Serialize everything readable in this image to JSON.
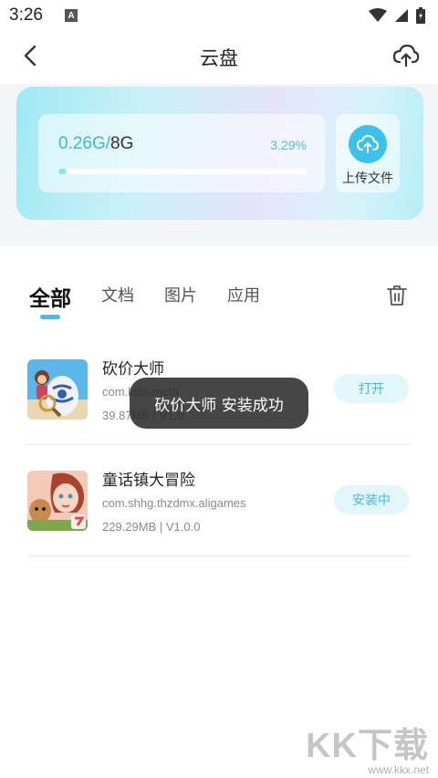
{
  "status_bar": {
    "time": "3:26",
    "notification_letter": "A"
  },
  "header": {
    "title": "云盘"
  },
  "storage": {
    "used": "0.26G",
    "separator": "/",
    "total": "8G",
    "percent_text": "3.29%",
    "percent_value": 3.29,
    "upload_label": "上传文件"
  },
  "tabs": [
    {
      "label": "全部",
      "active": true
    },
    {
      "label": "文档",
      "active": false
    },
    {
      "label": "图片",
      "active": false
    },
    {
      "label": "应用",
      "active": false
    }
  ],
  "apps": [
    {
      "name": "砍价大师",
      "package": "com.kjds.meta",
      "meta": "39.87MB | V1.0",
      "action": "打开"
    },
    {
      "name": "童话镇大冒险",
      "package": "com.shhg.thzdmx.aligames",
      "meta": "229.29MB | V1.0.0",
      "action": "安装中"
    }
  ],
  "toast": "砍价大师 安装成功",
  "watermark": {
    "logo": "KK下载",
    "url": "www.kkx.net"
  },
  "icons": {
    "back": "chevron-left-icon",
    "cloud_upload": "cloud-upload-icon",
    "upload": "upload-arrow-icon",
    "trash": "trash-icon",
    "wifi": "wifi-icon",
    "signal": "signal-icon",
    "battery": "battery-icon"
  },
  "colors": {
    "accent": "#3cc2ea",
    "button_bg": "#e3f6fc",
    "used_text": "#3fb6c9"
  }
}
